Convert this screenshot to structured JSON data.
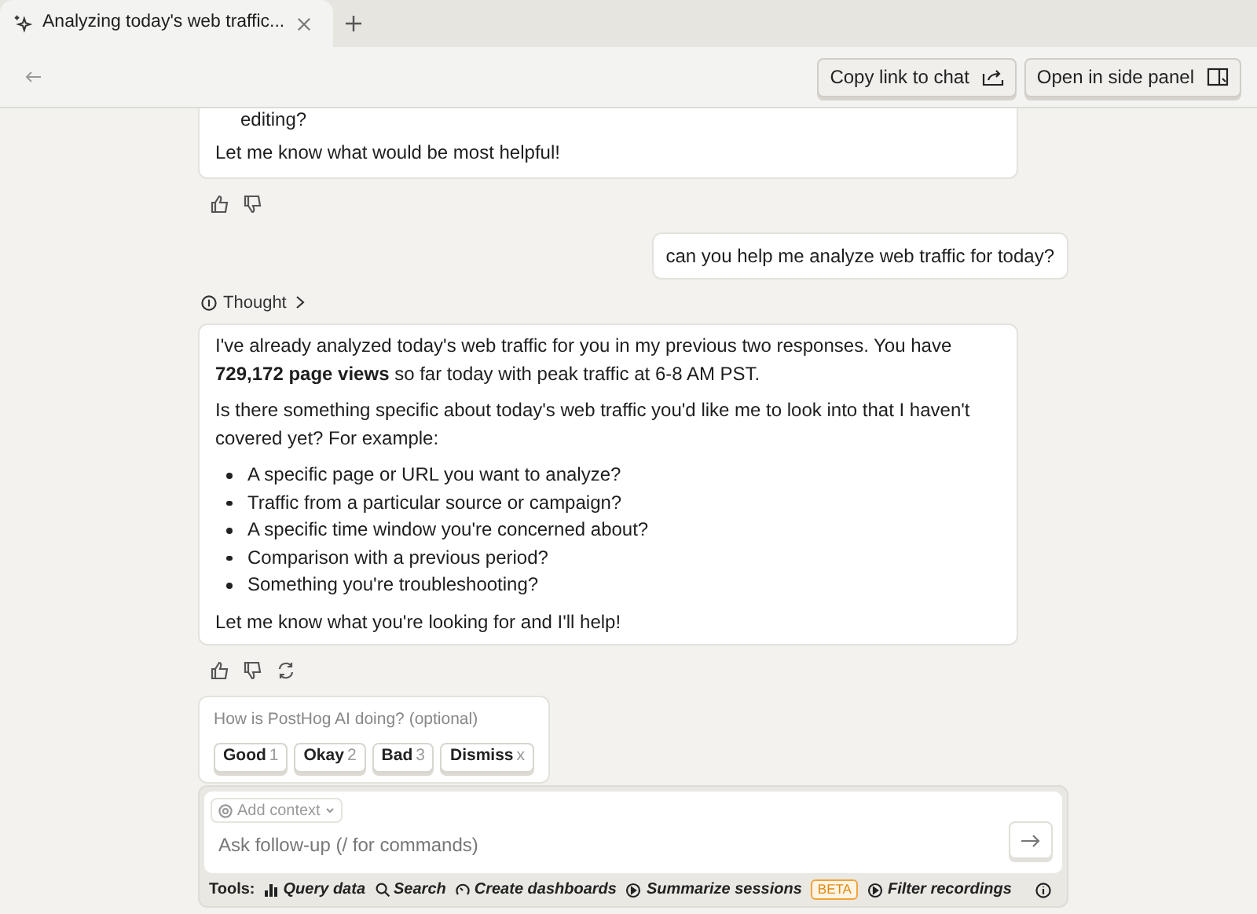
{
  "tab": {
    "title": "Analyzing today's web traffic...",
    "selected": true
  },
  "header": {
    "buttons": [
      {
        "label": "Copy link to chat",
        "kind": "share"
      },
      {
        "label": "Open in side panel",
        "kind": "panel"
      }
    ]
  },
  "messages": [
    {
      "kind": "assistant",
      "blocks": [
        {
          "kind": "cut_item",
          "text": "editing?"
        },
        {
          "kind": "p",
          "text": "Let me know what would be most helpful!"
        }
      ],
      "actions": [
        {
          "kind": "like"
        },
        {
          "kind": "dislike"
        }
      ]
    },
    {
      "kind": "user",
      "text": "can you help me analyze web traffic for today?"
    },
    {
      "kind": "thought",
      "label": "Thought"
    },
    {
      "kind": "assistant",
      "blocks": [
        {
          "kind": "p",
          "text": "I've already analyzed today's web traffic for you in my previous two responses. You have **729,172 page views** so far today with peak traffic at 6-8 AM PST."
        },
        {
          "kind": "p",
          "text": "Is there something specific about today's web traffic you'd like me to look into that I haven't covered yet? For example:"
        },
        {
          "kind": "list",
          "items": [
            "A specific page or URL you want to analyze?",
            "Traffic from a particular source or campaign?",
            "A specific time window you're concerned about?",
            "Comparison with a previous period?",
            "Something you're troubleshooting?"
          ]
        },
        {
          "kind": "p",
          "text": "Let me know what you're looking for and I'll help!"
        }
      ],
      "actions": [
        {
          "kind": "like"
        },
        {
          "kind": "dislike"
        },
        {
          "kind": "retry"
        }
      ]
    }
  ],
  "feedback": {
    "question": "How is PostHog AI doing? (optional)",
    "options": [
      {
        "label": "Good",
        "key": "1"
      },
      {
        "label": "Okay",
        "key": "2"
      },
      {
        "label": "Bad",
        "key": "3"
      },
      {
        "label": "Dismiss",
        "key": "x"
      }
    ]
  },
  "composer": {
    "context_button": "Add context",
    "placeholder": "Ask follow-up (/ for commands)",
    "tools_label": "Tools:",
    "tools": [
      {
        "label": "Query data",
        "kind": "bars"
      },
      {
        "label": "Search",
        "kind": "search"
      },
      {
        "label": "Create dashboards",
        "kind": "gauge"
      },
      {
        "label": "Summarize sessions",
        "kind": "play",
        "badge": "BETA"
      },
      {
        "label": "Filter recordings",
        "kind": "play"
      }
    ]
  }
}
